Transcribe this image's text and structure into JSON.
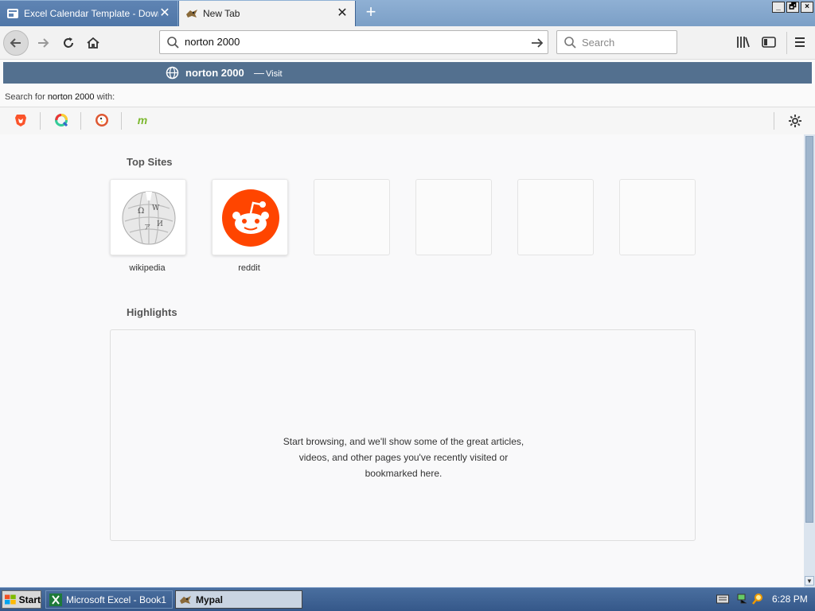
{
  "window": {
    "tabs": [
      {
        "title": "Excel Calendar Template - Downlo",
        "active": false
      },
      {
        "title": "New Tab",
        "active": true
      }
    ],
    "controls": [
      "_",
      "🗗",
      "×"
    ]
  },
  "navbar": {
    "url_value": "norton 2000",
    "search_placeholder": "Search"
  },
  "dropdown": {
    "suggestion_title": "norton 2000",
    "suggestion_sep": "—",
    "suggestion_action": "Visit",
    "search_with_prefix": "Search for ",
    "search_with_query": "norton 2000",
    "search_with_suffix": " with:",
    "engines": [
      "brave",
      "qwant",
      "duckduckgo",
      "mojeek"
    ]
  },
  "content": {
    "top_sites_title": "Top Sites",
    "top_sites": [
      {
        "label": "wikipedia",
        "icon": "wikipedia-globe"
      },
      {
        "label": "reddit",
        "icon": "reddit-alien"
      },
      {
        "label": ""
      },
      {
        "label": ""
      },
      {
        "label": ""
      },
      {
        "label": ""
      }
    ],
    "highlights_title": "Highlights",
    "highlights_empty_line1": "Start browsing, and we'll show some of the great articles,",
    "highlights_empty_line2": "videos, and other pages you've recently visited or",
    "highlights_empty_line3": "bookmarked here."
  },
  "taskbar": {
    "start_label": "Start",
    "items": [
      {
        "label": "Microsoft Excel - Book1",
        "active": false
      },
      {
        "label": "Mypal",
        "active": true
      }
    ],
    "clock": "6:28 PM"
  },
  "colors": {
    "suggestion_bg": "#53708f",
    "reddit_orange": "#ff4500",
    "taskbar": "#35588a"
  }
}
